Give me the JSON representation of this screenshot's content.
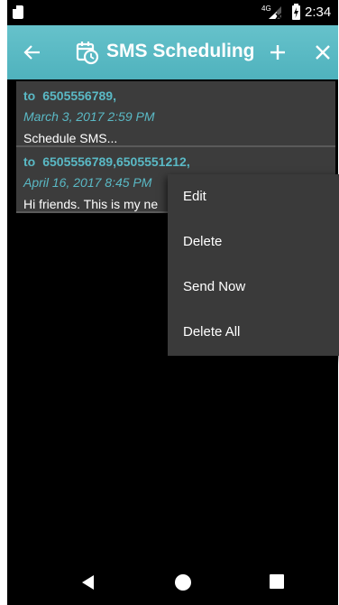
{
  "status_bar": {
    "network": "4G",
    "time": "2:34"
  },
  "app_bar": {
    "title": "SMS Scheduling",
    "icons": {
      "back": "arrow-left-icon",
      "title": "calendar-clock-icon",
      "add": "plus-icon",
      "close": "close-icon"
    }
  },
  "messages": [
    {
      "to_label": "to",
      "recipients": "6505556789,",
      "date": "March 3, 2017 2:59 PM",
      "text": "Schedule SMS..."
    },
    {
      "to_label": "to",
      "recipients": "6505556789,6505551212,",
      "date": "April 16, 2017 8:45 PM",
      "text": "Hi friends. This is my ne"
    }
  ],
  "context_menu": {
    "items": [
      {
        "label": "Edit"
      },
      {
        "label": "Delete"
      },
      {
        "label": "Send Now"
      },
      {
        "label": "Delete All"
      }
    ]
  },
  "nav_bar": {
    "icons": [
      "back-triangle-icon",
      "home-circle-icon",
      "recents-square-icon"
    ]
  },
  "colors": {
    "accent": "#4fb2bd",
    "link_text": "#5ab9c5",
    "list_item_bg": "#3c3c3c",
    "menu_bg": "#3a3a3a",
    "background": "#000000"
  }
}
